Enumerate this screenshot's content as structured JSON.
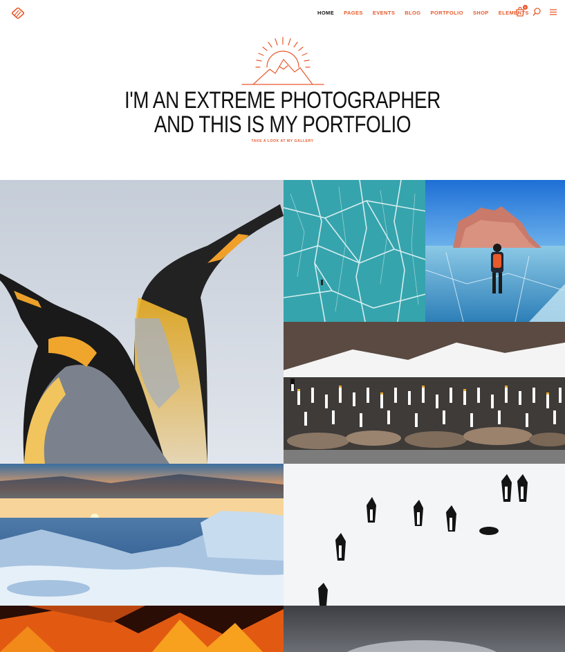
{
  "header": {
    "nav": [
      {
        "label": "HOME",
        "active": true
      },
      {
        "label": "PAGES"
      },
      {
        "label": "EVENTS"
      },
      {
        "label": "BLOG"
      },
      {
        "label": "PORTFOLIO"
      },
      {
        "label": "SHOP"
      },
      {
        "label": "ELEMENTS"
      }
    ],
    "cart_count": "0",
    "icons": [
      "logo-icon",
      "cart-icon",
      "search-icon",
      "menu-icon"
    ]
  },
  "hero": {
    "title_line1": "I'M AN EXTREME PHOTOGRAPHER",
    "title_line2": "AND THIS IS MY PORTFOLIO",
    "subtitle": "TAKE A LOOK AT MY GALLERY"
  },
  "gallery": [
    {
      "subject": "king penguins close-up"
    },
    {
      "subject": "cracked turquoise ice"
    },
    {
      "subject": "hiker on frozen lake by rock"
    },
    {
      "subject": "penguin colony with seals"
    },
    {
      "subject": "sunset over icy sea"
    },
    {
      "subject": "adelie penguins on snow"
    },
    {
      "subject": "campfire flames"
    },
    {
      "subject": "grey snowy landscape"
    }
  ],
  "colors": {
    "accent": "#e8592a",
    "text": "#111111"
  }
}
